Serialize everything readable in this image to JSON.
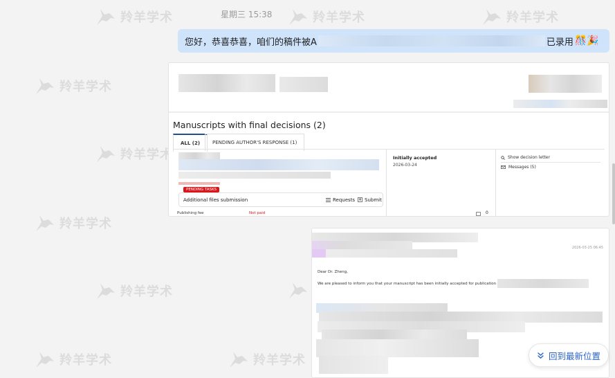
{
  "chat": {
    "timestamp": "星期三 15:38",
    "message_prefix": "您好，恭喜恭喜，咱们的稿件被A",
    "message_suffix": "已录用",
    "emoji": "🎊🎉"
  },
  "watermark": {
    "text": "羚羊学术"
  },
  "portal": {
    "section_title": "Manuscripts with final decisions (2)",
    "tabs": [
      {
        "label": "ALL (2)",
        "active": true
      },
      {
        "label": "PENDING AUTHOR'S RESPONSE (1)",
        "active": false
      }
    ],
    "pending_badge": "PENDING TASKS",
    "task_label": "Additional files submission",
    "requests_label": "Requests",
    "submit_label": "Submit",
    "fee_label": "Publishing fee",
    "fee_status": "Not paid",
    "status_title": "Initially accepted",
    "status_date": "2026-03-24",
    "count": "0",
    "actions": [
      {
        "label": "Show decision letter",
        "icon": "search-icon"
      },
      {
        "label": "Messages (5)",
        "icon": "mail-icon"
      }
    ]
  },
  "email": {
    "date": "2026-03-25 06:45",
    "greeting": "Dear Dr. Zheng,",
    "body_line": "We are pleased to inform you that your manuscript has been initially accepted for publication in A"
  },
  "navigation": {
    "back_to_latest": "回到最新位置"
  },
  "colors": {
    "bubble": "#cfe3fb",
    "accent": "#2b64c8",
    "badge": "#d8161b"
  }
}
